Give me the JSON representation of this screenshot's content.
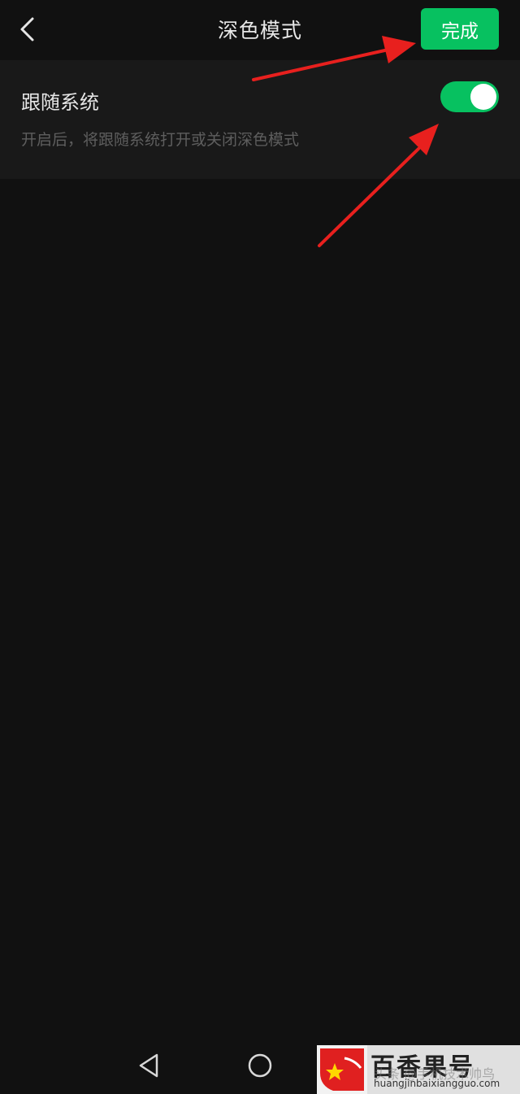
{
  "header": {
    "title": "深色模式",
    "done_label": "完成",
    "back_icon": "chevron-left-icon"
  },
  "setting": {
    "label": "跟随系统",
    "description": "开启后，将跟随系统打开或关闭深色模式",
    "toggle_on": true
  },
  "colors": {
    "background": "#111111",
    "panel": "#191919",
    "accent": "#07c160",
    "annotation_arrow": "#e8201e"
  },
  "navbar": {
    "icons": [
      "triangle-back-icon",
      "circle-home-icon"
    ]
  },
  "watermark": {
    "name": "百香果号",
    "domain": "huangjinbaixiangguo.com",
    "overlay_text": "头条 @手机技术帅鸟"
  }
}
